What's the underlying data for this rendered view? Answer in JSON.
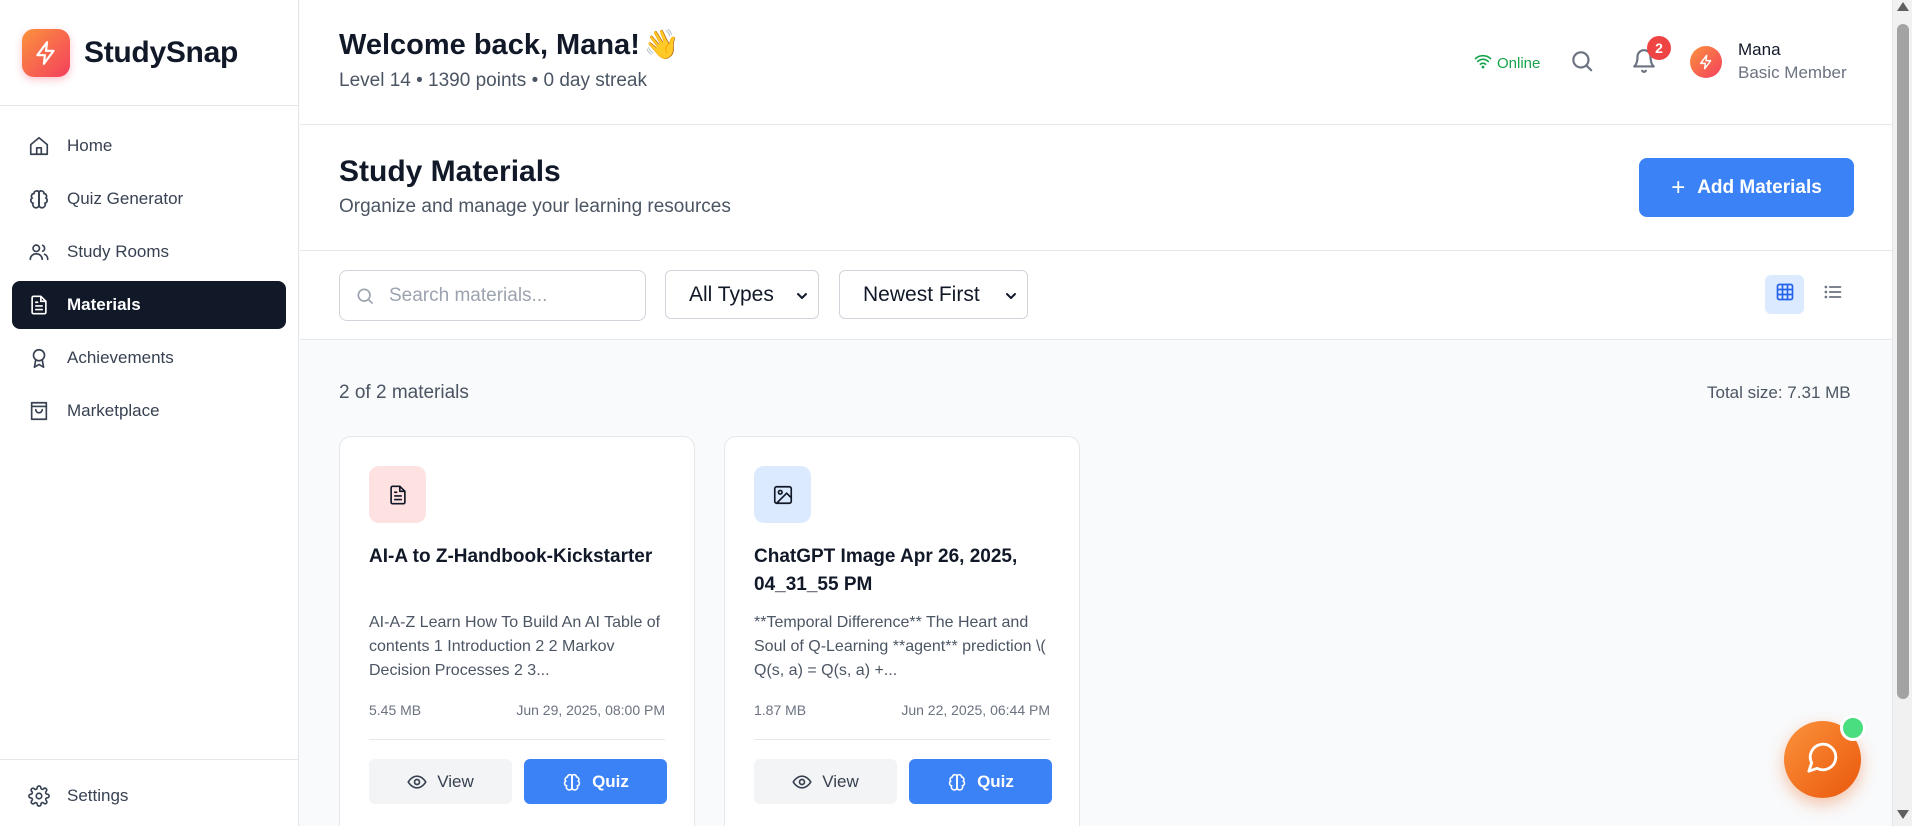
{
  "app": {
    "name": "StudySnap",
    "logo_icon": "lightning-bolt-icon",
    "accent_color": "#3b82f6",
    "brand_gradient": [
      "#fb923c",
      "#f43f5e"
    ]
  },
  "sidebar": {
    "items": [
      {
        "label": "Home",
        "icon": "home-icon",
        "active": false
      },
      {
        "label": "Quiz Generator",
        "icon": "brain-icon",
        "active": false
      },
      {
        "label": "Study Rooms",
        "icon": "users-icon",
        "active": false
      },
      {
        "label": "Materials",
        "icon": "document-icon",
        "active": true
      },
      {
        "label": "Achievements",
        "icon": "award-icon",
        "active": false
      },
      {
        "label": "Marketplace",
        "icon": "shopping-bag-icon",
        "active": false
      }
    ],
    "bottom_item": {
      "label": "Settings",
      "icon": "gear-icon"
    }
  },
  "header": {
    "greeting": "Welcome back, Mana!",
    "wave_emoji": "👋",
    "stats": "Level 14 • 1390 points • 0 day streak",
    "status": "Online",
    "status_color": "#16a34a",
    "notification_count": "2",
    "user": {
      "name": "Mana",
      "role": "Basic Member"
    }
  },
  "page": {
    "title": "Study Materials",
    "subtitle": "Organize and manage your learning resources",
    "add_button": {
      "label": "Add Materials",
      "plus": "+"
    }
  },
  "filters": {
    "search_placeholder": "Search materials...",
    "search_value": "",
    "type_selected": "All Types",
    "sort_selected": "Newest First",
    "view_mode": "grid"
  },
  "summary": {
    "count_text": "2 of 2 materials",
    "total_size": "Total size: 7.31 MB"
  },
  "materials": [
    {
      "title": "AI-A to Z-Handbook-Kickstarter",
      "icon": "document-icon",
      "icon_bg": "#fee2e2",
      "description": "AI-A-Z Learn How To Build An AI Table of contents 1 Introduction 2 2 Markov Decision Processes 2 3...",
      "size": "5.45 MB",
      "date": "Jun 29, 2025, 08:00 PM",
      "view_label": "View",
      "quiz_label": "Quiz"
    },
    {
      "title": "ChatGPT Image Apr 26, 2025, 04_31_55 PM",
      "icon": "image-icon",
      "icon_bg": "#dbeafe",
      "description": "**Temporal Difference** The Heart and Soul of Q-Learning **agent** prediction \\( Q(s, a) = Q(s, a) +...",
      "size": "1.87 MB",
      "date": "Jun 22, 2025, 06:44 PM",
      "view_label": "View",
      "quiz_label": "Quiz"
    }
  ],
  "chat": {
    "icon": "chat-bubble-icon",
    "online_dot_color": "#4ade80"
  }
}
